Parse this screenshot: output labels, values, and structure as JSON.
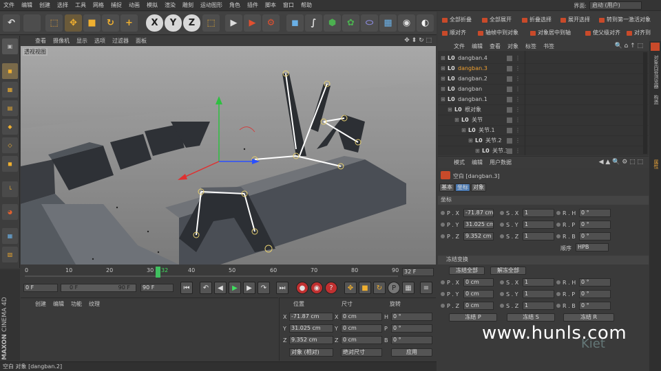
{
  "menubar": {
    "items": [
      "文件",
      "编辑",
      "创建",
      "选择",
      "工具",
      "网格",
      "捕捉",
      "动画",
      "模拟",
      "渲染",
      "雕刻",
      "运动图形",
      "角色",
      "插件",
      "脚本",
      "窗口",
      "帮助"
    ],
    "mode_label": "界面:",
    "mode_value": "启动 (用户)"
  },
  "toolbar": {
    "axis_x": "X",
    "axis_y": "Y",
    "axis_z": "Z"
  },
  "viewport": {
    "menu": [
      "查看",
      "摄像机",
      "显示",
      "选项",
      "过滤器",
      "面板"
    ],
    "label": "透视视图"
  },
  "timeline": {
    "ticks": [
      "0",
      "10",
      "20",
      "30",
      "40",
      "50",
      "60",
      "70",
      "80",
      "90"
    ],
    "current_frame_marker": "32",
    "end_field": "32 F"
  },
  "transport": {
    "start": "0 F",
    "range_start": "0 F",
    "range_end": "90 F",
    "end": "90 F"
  },
  "material_panel": {
    "menu": [
      "创建",
      "编辑",
      "功能",
      "纹理"
    ]
  },
  "coord_panel": {
    "headers": [
      "位置",
      "尺寸",
      "旋转"
    ],
    "rows": [
      {
        "axis": "X",
        "pos": "-71.87 cm",
        "size_axis": "X",
        "size": "0 cm",
        "rot_axis": "H",
        "rot": "0 °"
      },
      {
        "axis": "Y",
        "pos": "31.025 cm",
        "size_axis": "Y",
        "size": "0 cm",
        "rot_axis": "P",
        "rot": "0 °"
      },
      {
        "axis": "Z",
        "pos": "9.352 cm",
        "size_axis": "Z",
        "size": "0 cm",
        "rot_axis": "B",
        "rot": "0 °"
      }
    ],
    "mode_left": "对象 (相对)",
    "mode_right": "绝对尺寸",
    "apply": "应用"
  },
  "status": "空白 对象 [dangban.2]",
  "brand": {
    "maker": "MAXON",
    "product": "CINEMA 4D"
  },
  "right_toolbar": {
    "row1": [
      "全部折叠",
      "全部展开",
      "折叠选择",
      "展开选择",
      "转到第一激活对象"
    ],
    "row2": [
      "顺对齐",
      "轴帧中到对象",
      "对象居中到轴",
      "使父级对齐",
      "对齐到"
    ]
  },
  "object_manager": {
    "menu": [
      "文件",
      "编辑",
      "查看",
      "对象",
      "标签",
      "书签"
    ],
    "rows": [
      {
        "name": "dangban.4",
        "indent": 0,
        "selected": false
      },
      {
        "name": "dangban.3",
        "indent": 0,
        "selected": true
      },
      {
        "name": "dangban.2",
        "indent": 0,
        "selected": false
      },
      {
        "name": "dangban",
        "indent": 0,
        "selected": false
      },
      {
        "name": "dangban.1",
        "indent": 0,
        "selected": false
      },
      {
        "name": "根对象",
        "indent": 1,
        "selected": false
      },
      {
        "name": "关节",
        "indent": 2,
        "selected": false
      },
      {
        "name": "关节.1",
        "indent": 3,
        "selected": false
      },
      {
        "name": "关节.2",
        "indent": 4,
        "selected": false
      },
      {
        "name": "关节.3",
        "indent": 5,
        "selected": false
      }
    ]
  },
  "attributes": {
    "menu": [
      "模式",
      "编辑",
      "用户数据"
    ],
    "object_title": "空白 [dangban.3]",
    "tabs": [
      "基本",
      "坐标",
      "对象"
    ],
    "section": "坐标",
    "rows": [
      {
        "p_label": "P . X",
        "p": "-71.87 cm",
        "s_label": "S . X",
        "s": "1",
        "r_label": "R . H",
        "r": "0 °"
      },
      {
        "p_label": "P . Y",
        "p": "31.025 cm",
        "s_label": "S . Y",
        "s": "1",
        "r_label": "R . P",
        "r": "0 °"
      },
      {
        "p_label": "P . Z",
        "p": "9.352 cm",
        "s_label": "S . Z",
        "s": "1",
        "r_label": "R . B",
        "r": "0 °"
      }
    ],
    "order_label": "顺序",
    "order_value": "HPB",
    "freeze_section": "冻结变换",
    "freeze_all": "冻结全部",
    "unfreeze_all": "解冻全部",
    "frozen_rows": [
      {
        "p_label": "P . X",
        "p": "0 cm",
        "s_label": "S . X",
        "s": "1",
        "r_label": "R . H",
        "r": "0 °"
      },
      {
        "p_label": "P . Y",
        "p": "0 cm",
        "s_label": "S . Y",
        "s": "1",
        "r_label": "R . P",
        "r": "0 °"
      },
      {
        "p_label": "P . Z",
        "p": "0 cm",
        "s_label": "S . Z",
        "s": "1",
        "r_label": "R . B",
        "r": "0 °"
      }
    ],
    "freeze_p": "冻结 P",
    "freeze_s": "冻结 S",
    "freeze_r": "冻结 R"
  },
  "side_tabs": [
    "对象",
    "内容浏览器",
    "构造",
    "属性"
  ],
  "watermark": "www.hunls.com",
  "watermark_logo": "Kiet"
}
